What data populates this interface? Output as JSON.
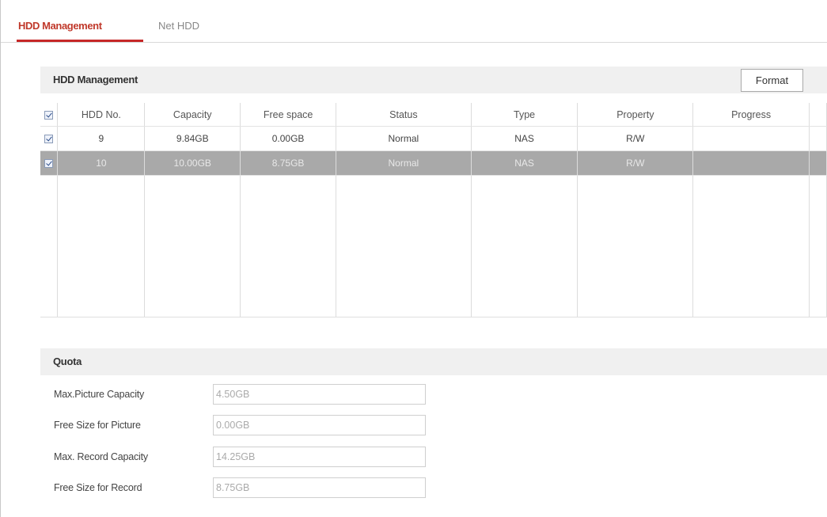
{
  "tabs": [
    {
      "label": "HDD Management",
      "active": true
    },
    {
      "label": "Net HDD",
      "active": false
    }
  ],
  "hdd_section": {
    "title": "HDD Management",
    "format_label": "Format",
    "columns": [
      "HDD No.",
      "Capacity",
      "Free space",
      "Status",
      "Type",
      "Property",
      "Progress"
    ],
    "rows": [
      {
        "checked": true,
        "selected": false,
        "hdd_no": "9",
        "capacity": "9.84GB",
        "free_space": "0.00GB",
        "status": "Normal",
        "type": "NAS",
        "property": "R/W",
        "progress": ""
      },
      {
        "checked": true,
        "selected": true,
        "hdd_no": "10",
        "capacity": "10.00GB",
        "free_space": "8.75GB",
        "status": "Normal",
        "type": "NAS",
        "property": "R/W",
        "progress": ""
      }
    ]
  },
  "quota": {
    "title": "Quota",
    "fields": [
      {
        "label": "Max.Picture Capacity",
        "value": "4.50GB"
      },
      {
        "label": "Free Size for Picture",
        "value": "0.00GB"
      },
      {
        "label": "Max. Record Capacity",
        "value": "14.25GB"
      },
      {
        "label": "Free Size for Record",
        "value": "8.75GB"
      }
    ]
  },
  "colors": {
    "accent": "#c62828",
    "selected_row": "#a9a9a9",
    "section_header_bg": "#f0f0f0"
  }
}
